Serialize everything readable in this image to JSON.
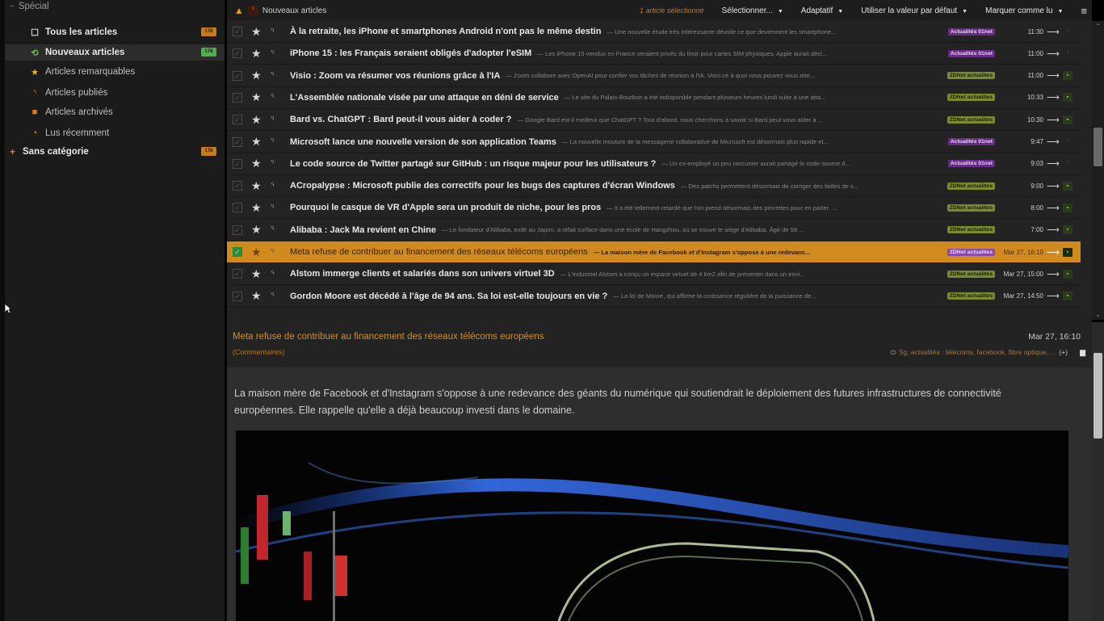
{
  "sidebar": {
    "special": {
      "label": "Spécial",
      "expander": "−"
    },
    "items": [
      {
        "label": "Tous les articles",
        "icon": "folder-icon",
        "badge": "178",
        "badge_color": "#c97b1c"
      },
      {
        "label": "Nouveaux articles",
        "icon": "new-icon",
        "badge": "178",
        "badge_color": "#4caf50"
      },
      {
        "label": "Articles remarquables",
        "icon": "star-icon"
      },
      {
        "label": "Articles publiés",
        "icon": "rss-icon"
      },
      {
        "label": "Articles archivés",
        "icon": "archive-icon"
      },
      {
        "label": "Lus récemment",
        "icon": "history-icon"
      }
    ],
    "category": {
      "label": "Sans catégorie",
      "expander": "+",
      "badge": "178"
    }
  },
  "toolbar": {
    "feed_title": "Nouveaux articles",
    "selected_count": "1 article sélectionné",
    "select_label": "Sélectionner...",
    "view_mode": "Adaptatif",
    "sort_mode": "Utiliser la valeur par défaut",
    "mark_read": "Marquer comme lu"
  },
  "articles": [
    {
      "title": "À la retraite, les iPhone et smartphones Android n'ont pas le même destin",
      "excerpt": "— Une nouvelle étude très intéressante dévoile ce que deviennent les smartphone...",
      "label": "Actualités 01net",
      "label_type": "p",
      "time": "11:30",
      "doc": false
    },
    {
      "title": "iPhone 15 : les Français seraient obligés d'adopter l'eSIM",
      "excerpt": "— Les iPhone 15 vendus en France seraient privés du tiroir pour cartes SIM physiques. Apple aurait déci...",
      "label": "Actualités 01net",
      "label_type": "p",
      "time": "11:00",
      "doc": false
    },
    {
      "title": "Visio : Zoom va résumer vos réunions grâce à l'IA",
      "excerpt": "— Zoom collabore avec OpenAI pour confier vos tâches de réunion à l'IA. Voici ce à quoi vous pouvez vous atte...",
      "label": "ZDNet actualites",
      "label_type": "g",
      "time": "11:00",
      "doc": true
    },
    {
      "title": "L'Assemblée nationale visée par une attaque en déni de service",
      "excerpt": "— Le site du Palais-Bourbon a été indisponible pendant plusieurs heures lundi suite à une atta...",
      "label": "ZDNet actualites",
      "label_type": "g",
      "time": "10:33",
      "doc": true
    },
    {
      "title": "Bard vs. ChatGPT : Bard peut-il vous aider à coder ?",
      "excerpt": "— Google Bard est-il meilleur que ChatGPT ? Tout d'abord, nous cherchons à savoir si Bard peut vous aider à ...",
      "label": "ZDNet actualites",
      "label_type": "g",
      "time": "10:30",
      "doc": true
    },
    {
      "title": "Microsoft lance une nouvelle version de son application Teams",
      "excerpt": "— La nouvelle mouture de la messagerie collaborative de Microsoft est désormais plus rapide et...",
      "label": "Actualités 01net",
      "label_type": "p",
      "time": "9:47",
      "doc": false
    },
    {
      "title": "Le code source de Twitter partagé sur GitHub : un risque majeur pour les utilisateurs ?",
      "excerpt": "— Un ex-employé un peu rancunier aurait partagé le code-source d...",
      "label": "Actualités 01net",
      "label_type": "p",
      "time": "9:03",
      "doc": false
    },
    {
      "title": "ACropalypse : Microsoft publie des correctifs pour les bugs des captures d'écran Windows",
      "excerpt": "— Des patchs permettent désormais de corriger des failles de s...",
      "label": "ZDNet actualites",
      "label_type": "g",
      "time": "9:00",
      "doc": true
    },
    {
      "title": "Pourquoi le casque de VR d'Apple sera un produit de niche, pour les pros",
      "excerpt": "— Il a été tellement retardé que l'on prend désormais des pincettes pour en parler. ...",
      "label": "ZDNet actualites",
      "label_type": "g",
      "time": "8:00",
      "doc": true
    },
    {
      "title": "Alibaba : Jack Ma revient en Chine",
      "excerpt": "— Le fondateur d'Alibaba, exilé au Japon, a refait surface dans une école de Hangzhou, où se trouve le siège d'Alibaba. Âgé de 58 ...",
      "label": "ZDNet actualites",
      "label_type": "g",
      "time": "7:00",
      "doc": true
    },
    {
      "title": "Meta refuse de contribuer au financement des réseaux télécoms européens",
      "excerpt": "— La maison mère de Facebook et d'Instagram s'oppose à une redevanc...",
      "label": "ZDNet actualites",
      "label_type": "p",
      "time": "Mar 27, 16:10",
      "doc": true,
      "selected": true
    },
    {
      "title": "Alstom immerge clients et salariés dans son univers virtuel 3D",
      "excerpt": "— L'industriel Alstom a conçu un espace virtuel de 4 km2 afin de présenter dans un envi...",
      "label": "ZDNet actualites",
      "label_type": "g",
      "time": "Mar 27, 15:00",
      "doc": true
    },
    {
      "title": "Gordon Moore est décédé à l'âge de 94 ans. Sa loi est-elle toujours en vie ?",
      "excerpt": "— La loi de Moore, qui affirme la croissance régulière de la puissance de...",
      "label": "ZDNet actualites",
      "label_type": "g",
      "time": "Mar 27, 14:50",
      "doc": true
    }
  ],
  "reader": {
    "title": "Meta refuse de contribuer au financement des réseaux télécoms européens",
    "date": "Mar 27, 16:10",
    "comments": "(Commentaires)",
    "tags": "5g, actualités : télécoms, facebook, fibre optique, ...",
    "tags_more": "(+)",
    "body": "La maison mère de Facebook et d'Instagram s'oppose à une redevance des géants du numérique qui soutiendrait le déploiement des futures infrastructures de connectivité européennes. Elle rappelle qu'elle a déjà beaucoup investi dans le domaine."
  },
  "colors": {
    "accent": "#d18a1e",
    "selected_row": "#d18a1e",
    "label_green": "#7b8b2a",
    "label_purple": "#6a2a8a"
  }
}
